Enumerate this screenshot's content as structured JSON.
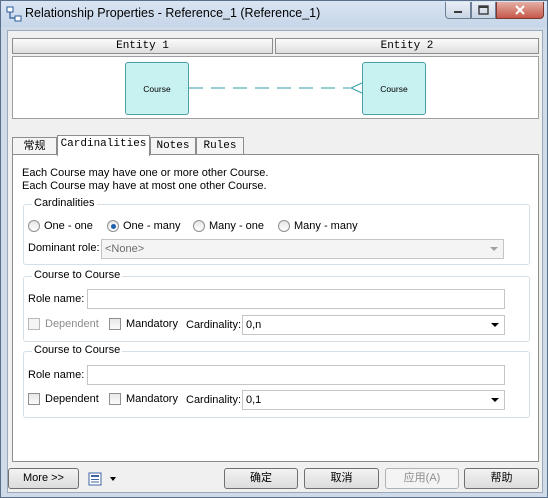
{
  "window": {
    "title": "Relationship Properties - Reference_1 (Reference_1)",
    "icons": {
      "app": "relationship-icon",
      "minimize": "minimize-icon",
      "maximize": "maximize-icon",
      "close": "close-icon"
    }
  },
  "entities": {
    "entity1_header": "Entity 1",
    "entity2_header": "Entity 2",
    "entity1_name": "Course",
    "entity2_name": "Course"
  },
  "tabs": [
    {
      "label": "常规",
      "active": false
    },
    {
      "label": "Cardinalities",
      "active": true
    },
    {
      "label": "Notes",
      "active": false
    },
    {
      "label": "Rules",
      "active": false
    }
  ],
  "description": {
    "line1": "Each Course may have one or more other Course.",
    "line2": "Each Course may have at most one other Course."
  },
  "cardinalities": {
    "group_label": "Cardinalities",
    "options": [
      {
        "label": "One - one",
        "selected": false
      },
      {
        "label": "One - many",
        "selected": true
      },
      {
        "label": "Many - one",
        "selected": false
      },
      {
        "label": "Many - many",
        "selected": false
      }
    ],
    "dominant_role_label": "Dominant role:",
    "dominant_role_value": "<None>"
  },
  "role1": {
    "group_label": "Course to Course",
    "role_name_label": "Role name:",
    "role_name_value": "",
    "dependent_label": "Dependent",
    "dependent_checked": false,
    "dependent_enabled": false,
    "mandatory_label": "Mandatory",
    "mandatory_checked": false,
    "cardinality_label": "Cardinality:",
    "cardinality_value": "0,n"
  },
  "role2": {
    "group_label": "Course to Course",
    "role_name_label": "Role name:",
    "role_name_value": "",
    "dependent_label": "Dependent",
    "dependent_checked": false,
    "dependent_enabled": true,
    "mandatory_label": "Mandatory",
    "mandatory_checked": false,
    "cardinality_label": "Cardinality:",
    "cardinality_value": "0,1"
  },
  "footer": {
    "more_label": "More >>",
    "tool_icon": "toolbar-menu-icon",
    "ok_label": "确定",
    "cancel_label": "取消",
    "apply_label": "应用(A)",
    "help_label": "帮助"
  },
  "colors": {
    "entity_fill": "#c8f1f1",
    "entity_border": "#4d9fa6",
    "link_line": "#2f9ea5",
    "radio_selected": "#1e5fae"
  }
}
